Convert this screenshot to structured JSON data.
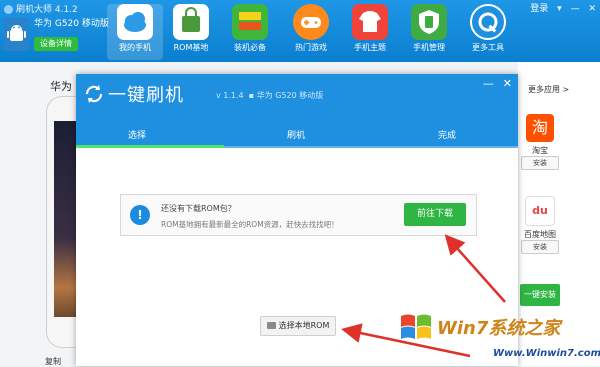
{
  "window": {
    "title": "刷机大师 4.1.2",
    "login": "登录",
    "controls": [
      "▾",
      "—",
      "✕"
    ]
  },
  "device": {
    "name": "华为 G520 移动版",
    "details_button": "设备详情"
  },
  "nav": [
    {
      "label": "我的手机",
      "icon": "cloud-icon",
      "active": true
    },
    {
      "label": "ROM基地",
      "icon": "shopping-bag-icon"
    },
    {
      "label": "装机必备",
      "icon": "apps-icon"
    },
    {
      "label": "热门游戏",
      "icon": "gamepad-icon"
    },
    {
      "label": "手机主题",
      "icon": "tshirt-icon"
    },
    {
      "label": "手机管理",
      "icon": "shield-icon"
    },
    {
      "label": "更多工具",
      "icon": "wrench-icon"
    }
  ],
  "left_panel": {
    "label": "华为",
    "copy": "复制"
  },
  "right_panel": {
    "more_apps": "更多应用 >",
    "apps": [
      {
        "name": "淘宝",
        "install": "安装",
        "icon_text": "淘",
        "color": "#ff5000"
      },
      {
        "name": "百度地图",
        "install": "安装",
        "icon_text": "du",
        "color": "#e8453c"
      }
    ],
    "one_click_install": "一键安装"
  },
  "dialog": {
    "title": "一键刷机",
    "version": "v 1.1.4",
    "device": "华为 G520 移动版",
    "steps": [
      "选择",
      "刷机",
      "完成"
    ],
    "active_step": 0,
    "notice": {
      "line1": "还没有下载ROM包？",
      "line2": "ROM基地拥有最新最全的ROM资源，赶快去找找吧！",
      "button": "前往下载"
    },
    "local_button": "选择本地ROM"
  },
  "watermark": {
    "brand": "Win7系统之家",
    "url": "Www.Winwin7.com"
  },
  "colors": {
    "header_blue": "#1f8fe0",
    "green": "#2fb544",
    "arrow_red": "#e0302a"
  }
}
